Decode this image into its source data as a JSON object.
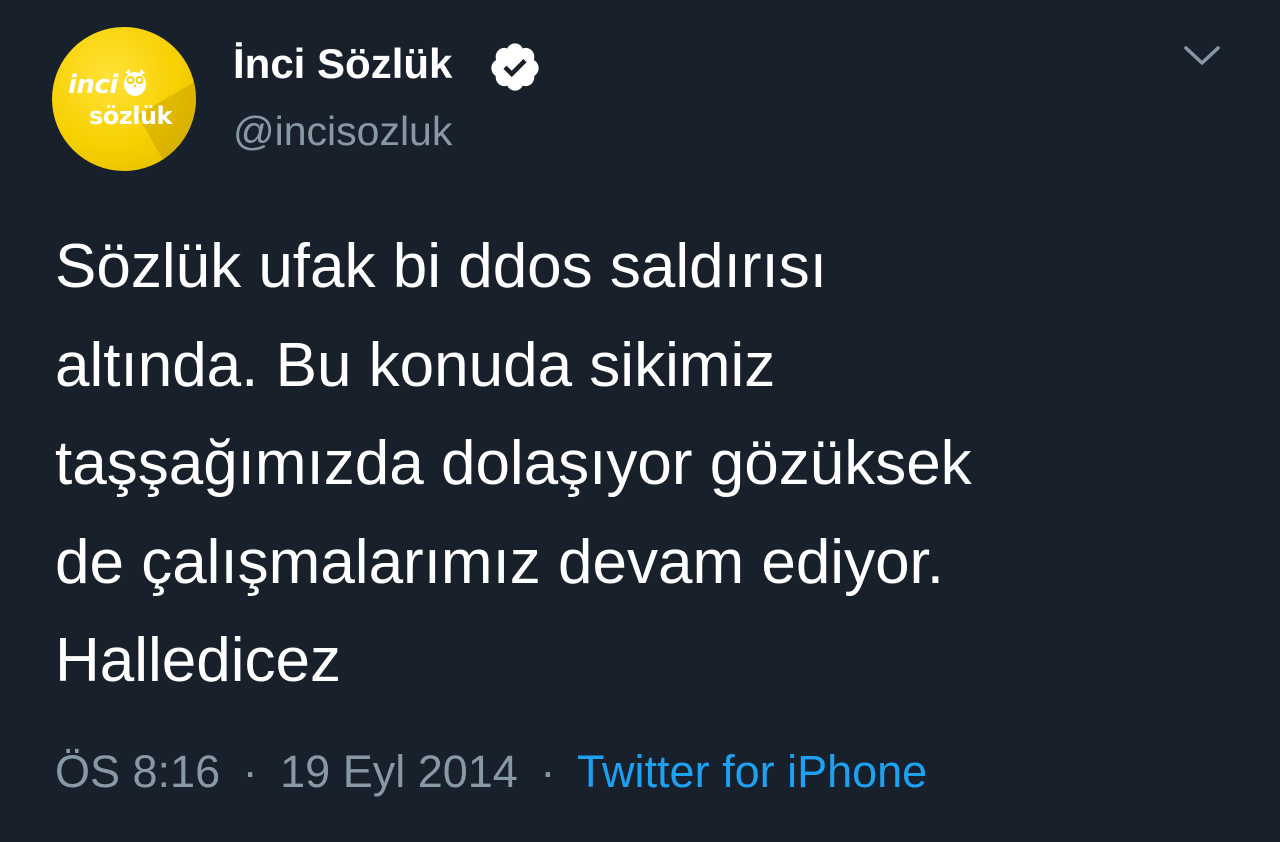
{
  "author": {
    "display_name": "İnci Sözlük",
    "handle": "@incisozluk",
    "avatar_logo": {
      "line1": "inci",
      "line2": "sözlük",
      "background_color": "#f7d000"
    },
    "verified": true
  },
  "tweet": {
    "lines": [
      "Sözlük ufak bi ddos saldırısı",
      "altında. Bu konuda sikimiz",
      "taşşağımızda dolaşıyor gözüksek",
      "de çalışmalarımız devam ediyor.",
      "Halledicez"
    ]
  },
  "meta": {
    "time": "ÖS 8:16",
    "separator": "·",
    "date": "19 Eyl 2014",
    "source": "Twitter for iPhone"
  },
  "icons": {
    "verified": "verified-badge-icon",
    "menu": "chevron-down-icon"
  },
  "colors": {
    "background": "#18202b",
    "text_primary": "#ffffff",
    "text_secondary": "#8899a6",
    "link": "#1da1f2"
  }
}
